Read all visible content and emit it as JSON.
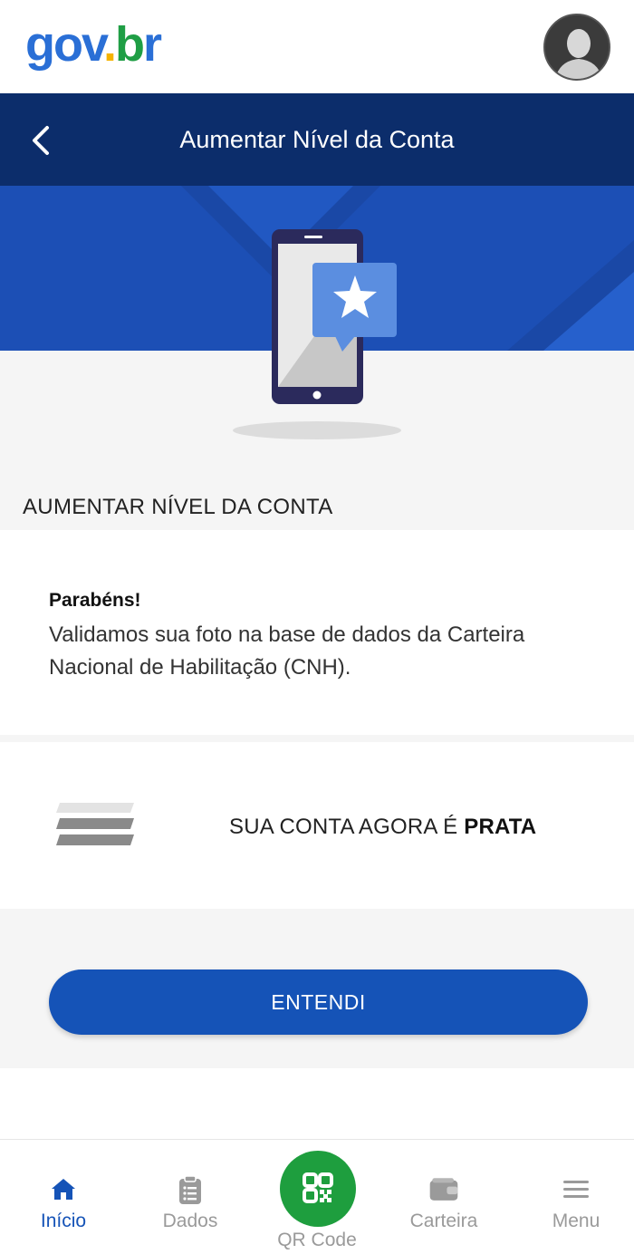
{
  "app": {
    "logo": {
      "part1": "gov",
      "part2": ".",
      "part3": "b",
      "part4": "r"
    }
  },
  "header": {
    "title": "Aumentar Nível da Conta"
  },
  "section": {
    "label": "AUMENTAR NÍVEL DA CONTA"
  },
  "message": {
    "title": "Parabéns!",
    "body": "Validamos sua foto na base de dados da Carteira Nacional de Habilitação (CNH)."
  },
  "level": {
    "prefix": "SUA CONTA AGORA É ",
    "value": "PRATA"
  },
  "actions": {
    "confirm_label": "ENTENDI"
  },
  "tabbar": {
    "items": [
      {
        "label": "Início",
        "icon": "home-icon",
        "active": true
      },
      {
        "label": "Dados",
        "icon": "clipboard-icon",
        "active": false
      },
      {
        "label": "QR Code",
        "icon": "qr-code-icon",
        "active": false
      },
      {
        "label": "Carteira",
        "icon": "wallet-icon",
        "active": false
      },
      {
        "label": "Menu",
        "icon": "menu-icon",
        "active": false
      }
    ]
  },
  "colors": {
    "header_bg": "#0c2d6b",
    "hero_bg": "#1c4fb5",
    "primary_button": "#1553b7",
    "qr_green": "#1e9e3e",
    "active_tab": "#1553b7"
  }
}
